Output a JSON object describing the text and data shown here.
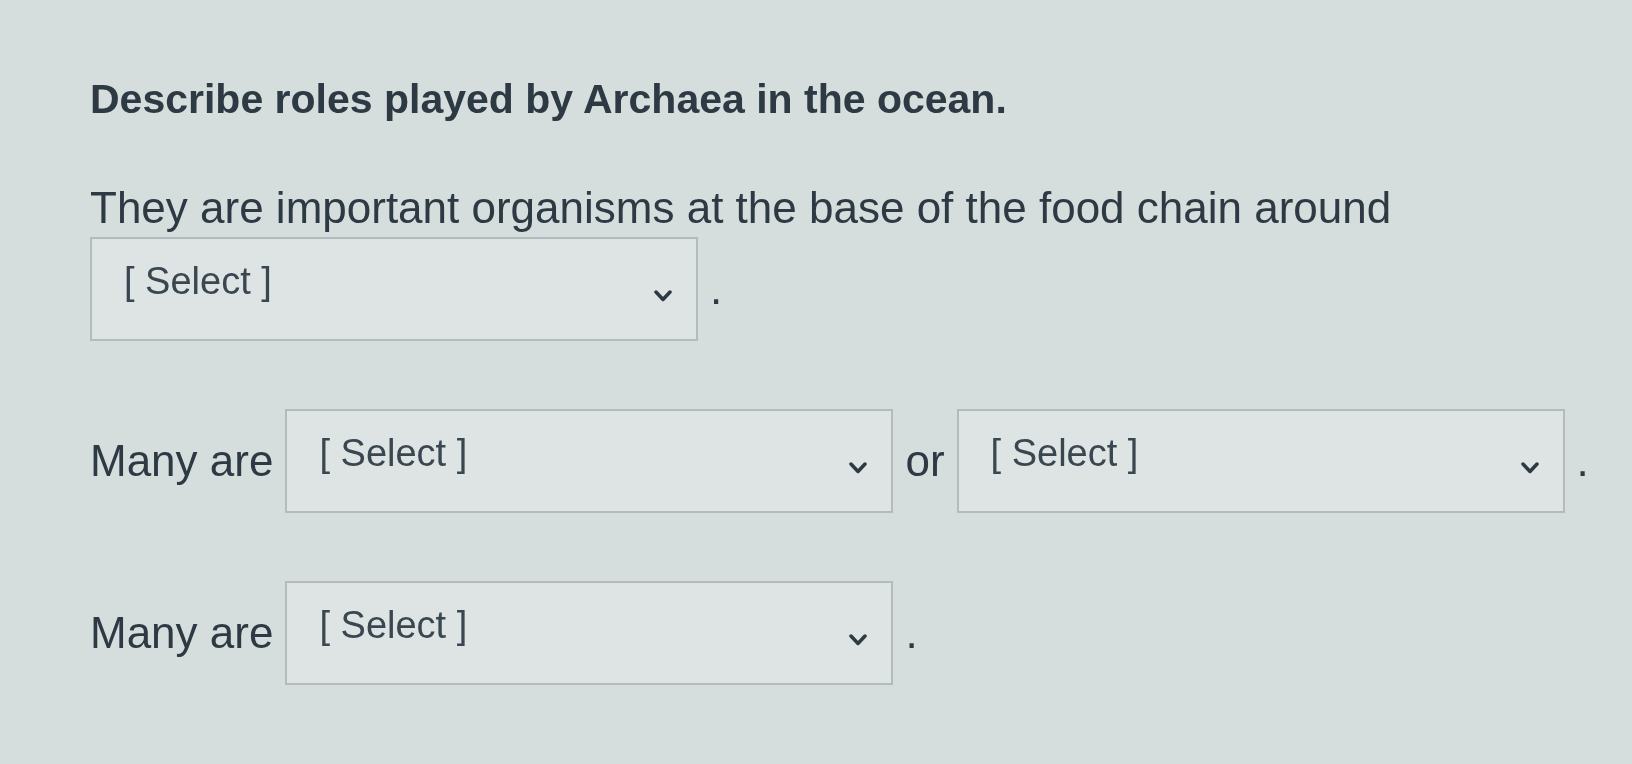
{
  "question": {
    "title": "Describe roles played by Archaea in the ocean."
  },
  "paragraphs": [
    {
      "parts": [
        {
          "kind": "text",
          "text": "They are important organisms at the base of the food chain around"
        },
        {
          "kind": "select",
          "value": "[ Select ]"
        },
        {
          "kind": "text",
          "text": "."
        }
      ]
    },
    {
      "parts": [
        {
          "kind": "text",
          "text": "Many are"
        },
        {
          "kind": "select",
          "value": "[ Select ]"
        },
        {
          "kind": "text",
          "text": "or"
        },
        {
          "kind": "select",
          "value": "[ Select ]"
        },
        {
          "kind": "text",
          "text": "."
        }
      ]
    },
    {
      "parts": [
        {
          "kind": "text",
          "text": "Many are"
        },
        {
          "kind": "select",
          "value": "[ Select ]"
        },
        {
          "kind": "text",
          "text": "."
        }
      ]
    }
  ]
}
